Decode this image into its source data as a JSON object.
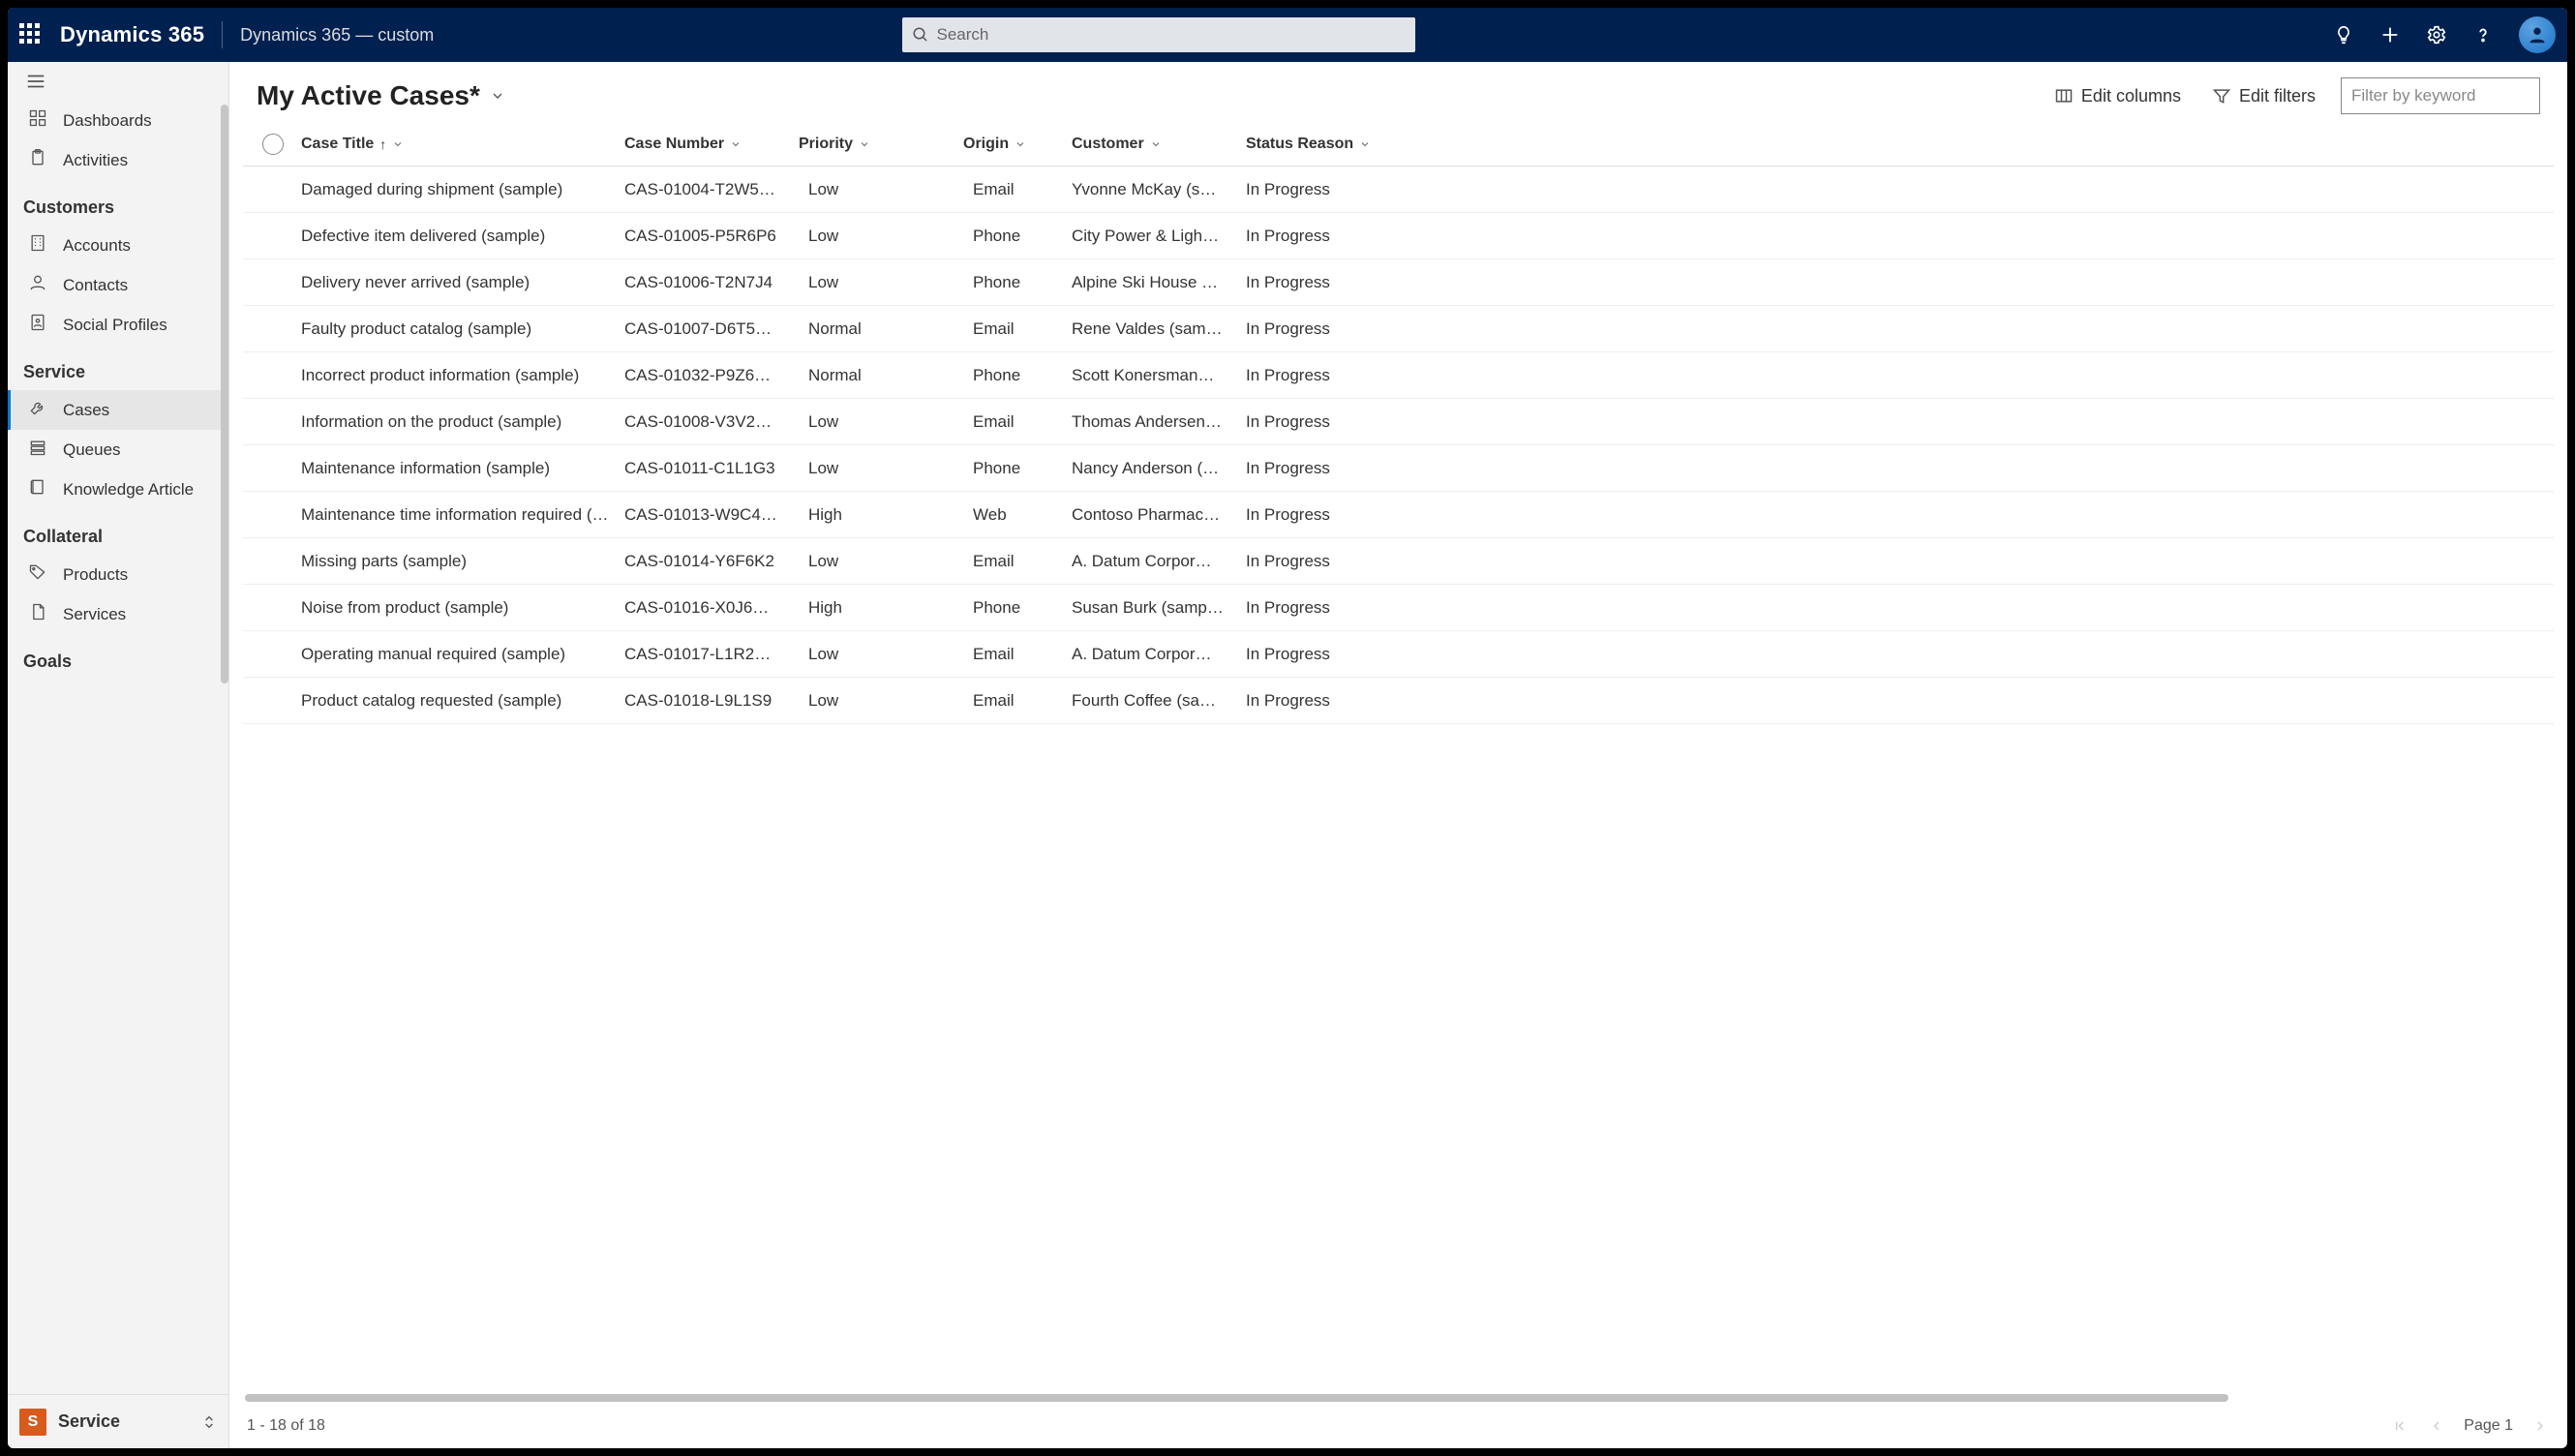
{
  "topbar": {
    "brand": "Dynamics 365",
    "env": "Dynamics 365 — custom",
    "search_placeholder": "Search"
  },
  "sidebar": {
    "top_items": [
      {
        "label": "Dashboards",
        "icon": "dashboard"
      },
      {
        "label": "Activities",
        "icon": "clipboard"
      }
    ],
    "groups": [
      {
        "name": "Customers",
        "items": [
          {
            "label": "Accounts",
            "icon": "building"
          },
          {
            "label": "Contacts",
            "icon": "person"
          },
          {
            "label": "Social Profiles",
            "icon": "id-badge"
          }
        ]
      },
      {
        "name": "Service",
        "items": [
          {
            "label": "Cases",
            "icon": "wrench",
            "active": true
          },
          {
            "label": "Queues",
            "icon": "stack"
          },
          {
            "label": "Knowledge Article",
            "icon": "book"
          }
        ]
      },
      {
        "name": "Collateral",
        "items": [
          {
            "label": "Products",
            "icon": "tag"
          },
          {
            "label": "Services",
            "icon": "file"
          }
        ]
      },
      {
        "name": "Goals",
        "items": []
      }
    ],
    "footer_badge": "S",
    "footer_label": "Service"
  },
  "view": {
    "title": "My Active Cases*",
    "edit_columns": "Edit columns",
    "edit_filters": "Edit filters",
    "filter_placeholder": "Filter by keyword"
  },
  "columns": {
    "title": "Case Title",
    "number": "Case Number",
    "priority": "Priority",
    "origin": "Origin",
    "customer": "Customer",
    "status": "Status Reason"
  },
  "rows": [
    {
      "title": "Damaged during shipment (sample)",
      "number": "CAS-01004-T2W5…",
      "priority": "Low",
      "origin": "Email",
      "customer": "Yvonne McKay (s…",
      "status": "In Progress"
    },
    {
      "title": "Defective item delivered (sample)",
      "number": "CAS-01005-P5R6P6",
      "priority": "Low",
      "origin": "Phone",
      "customer": "City Power & Ligh…",
      "status": "In Progress"
    },
    {
      "title": "Delivery never arrived (sample)",
      "number": "CAS-01006-T2N7J4",
      "priority": "Low",
      "origin": "Phone",
      "customer": "Alpine Ski House …",
      "status": "In Progress"
    },
    {
      "title": "Faulty product catalog (sample)",
      "number": "CAS-01007-D6T5…",
      "priority": "Normal",
      "origin": "Email",
      "customer": "Rene Valdes (sam…",
      "status": "In Progress"
    },
    {
      "title": "Incorrect product information (sample)",
      "number": "CAS-01032-P9Z6…",
      "priority": "Normal",
      "origin": "Phone",
      "customer": "Scott Konersman…",
      "status": "In Progress"
    },
    {
      "title": "Information on the product (sample)",
      "number": "CAS-01008-V3V2…",
      "priority": "Low",
      "origin": "Email",
      "customer": "Thomas Andersen…",
      "status": "In Progress"
    },
    {
      "title": "Maintenance information (sample)",
      "number": "CAS-01011-C1L1G3",
      "priority": "Low",
      "origin": "Phone",
      "customer": "Nancy Anderson (…",
      "status": "In Progress"
    },
    {
      "title": "Maintenance time information required (s…",
      "number": "CAS-01013-W9C4…",
      "priority": "High",
      "origin": "Web",
      "customer": "Contoso Pharmac…",
      "status": "In Progress"
    },
    {
      "title": "Missing parts (sample)",
      "number": "CAS-01014-Y6F6K2",
      "priority": "Low",
      "origin": "Email",
      "customer": "A. Datum Corpor…",
      "status": "In Progress"
    },
    {
      "title": "Noise from product (sample)",
      "number": "CAS-01016-X0J6…",
      "priority": "High",
      "origin": "Phone",
      "customer": "Susan Burk (samp…",
      "status": "In Progress"
    },
    {
      "title": "Operating manual required (sample)",
      "number": "CAS-01017-L1R2…",
      "priority": "Low",
      "origin": "Email",
      "customer": "A. Datum Corpor…",
      "status": "In Progress"
    },
    {
      "title": "Product catalog requested (sample)",
      "number": "CAS-01018-L9L1S9",
      "priority": "Low",
      "origin": "Email",
      "customer": "Fourth Coffee (sa…",
      "status": "In Progress"
    }
  ],
  "footer": {
    "range": "1 - 18 of 18",
    "page": "Page 1"
  }
}
